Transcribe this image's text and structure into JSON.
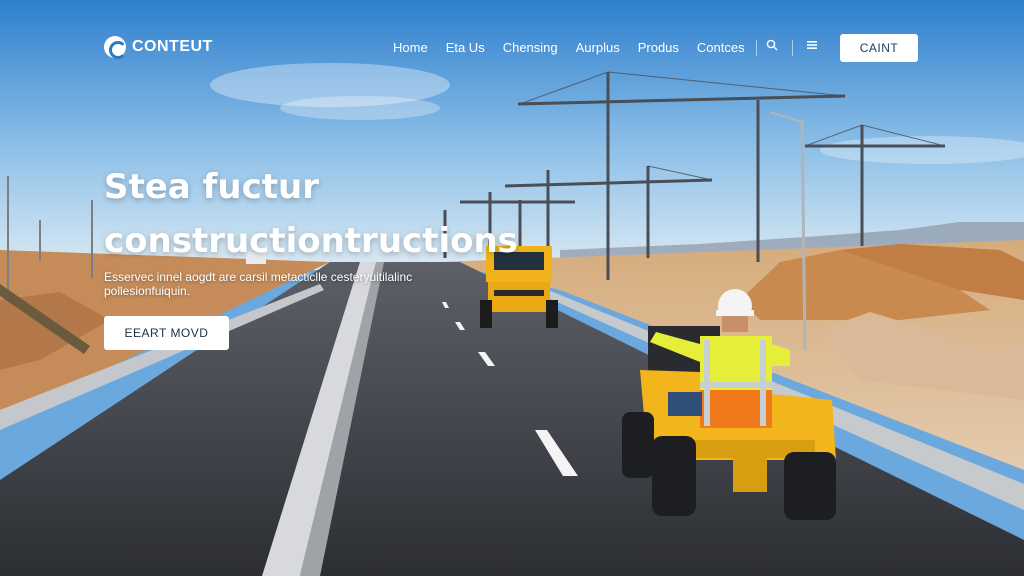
{
  "brand": {
    "name": "CONTEUT"
  },
  "nav": {
    "items": [
      "Home",
      "Eta Us",
      "Chensing",
      "Aurplus",
      "Produs",
      "Contces"
    ],
    "cta_label": "CAINT"
  },
  "hero": {
    "title_line1": "Stea fuctur",
    "title_line2": "constructiontructions",
    "subtitle": "Esservec innel aogdt are carsil metacticlle cesteryuitilalinc pollesionfuiquin.",
    "button_label": "EEART MOVD"
  },
  "colors": {
    "sky_top": "#3f8fd6",
    "sky_bottom": "#cfe3f1",
    "road": "#3d4047",
    "dirt": "#c98d5a",
    "vest": "#e8f23a",
    "vest_orange": "#f07a1b",
    "machine_yellow": "#f2b51b"
  }
}
